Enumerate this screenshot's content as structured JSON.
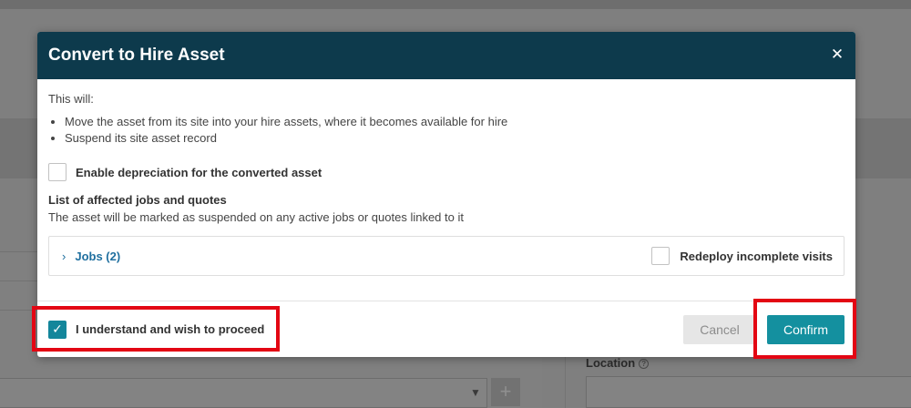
{
  "background": {
    "location_label": "Location",
    "help_icon": "question-circle-icon",
    "select_caret_icon": "caret-down-icon",
    "add_icon": "plus-icon"
  },
  "modal": {
    "title": "Convert to Hire Asset",
    "close_icon": "close-icon",
    "intro": "This will:",
    "bullets": [
      "Move the asset from its site into your hire assets, where it becomes available for hire",
      "Suspend its site asset record"
    ],
    "depreciation_label": "Enable depreciation for the converted asset",
    "depreciation_checked": false,
    "affected_title": "List of affected jobs and quotes",
    "affected_desc": "The asset will be marked as suspended on any active jobs or quotes linked to it",
    "jobs_label": "Jobs (2)",
    "redeploy_label": "Redeploy incomplete visits",
    "redeploy_checked": false,
    "understand_label": "I understand and wish to proceed",
    "understand_checked": true,
    "cancel_label": "Cancel",
    "confirm_label": "Confirm"
  },
  "colors": {
    "header_bg": "#0d3a4c",
    "accent": "#14909f",
    "link": "#1f6f9f",
    "highlight": "#e30613"
  }
}
